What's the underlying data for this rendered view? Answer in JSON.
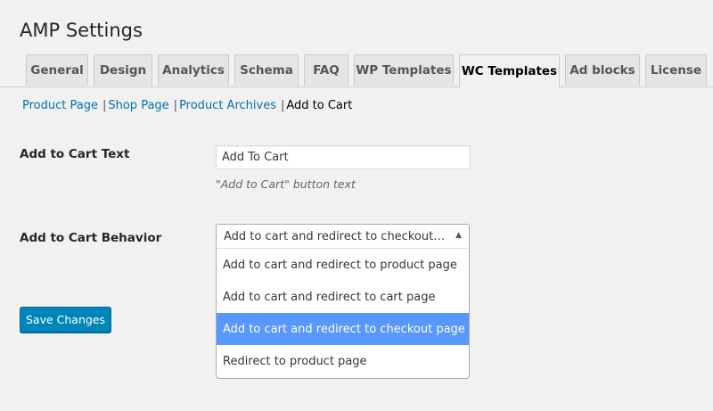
{
  "page": {
    "title": "AMP Settings"
  },
  "tabs": [
    {
      "label": "General"
    },
    {
      "label": "Design"
    },
    {
      "label": "Analytics"
    },
    {
      "label": "Schema"
    },
    {
      "label": "FAQ"
    },
    {
      "label": "WP Templates"
    },
    {
      "label": "WC Templates",
      "active": true
    },
    {
      "label": "Ad blocks"
    },
    {
      "label": "License"
    }
  ],
  "subnav": {
    "items": [
      "Product Page",
      "Shop Page",
      "Product Archives",
      "Add to Cart"
    ],
    "current": "Add to Cart"
  },
  "form": {
    "cart_text": {
      "label": "Add to Cart Text",
      "value": "Add To Cart",
      "description": "\"Add to Cart\" button text"
    },
    "cart_behavior": {
      "label": "Add to Cart Behavior",
      "selected": "Add to cart and redirect to checkout page",
      "options": [
        "Add to cart and redirect to product page",
        "Add to cart and redirect to cart page",
        "Add to cart and redirect to checkout page",
        "Redirect to product page"
      ],
      "highlighted_index": 2
    }
  },
  "actions": {
    "save_label": "Save Changes"
  },
  "colors": {
    "link": "#0073aa",
    "primary_button": "#0085ba",
    "option_highlight": "#5897fb"
  }
}
